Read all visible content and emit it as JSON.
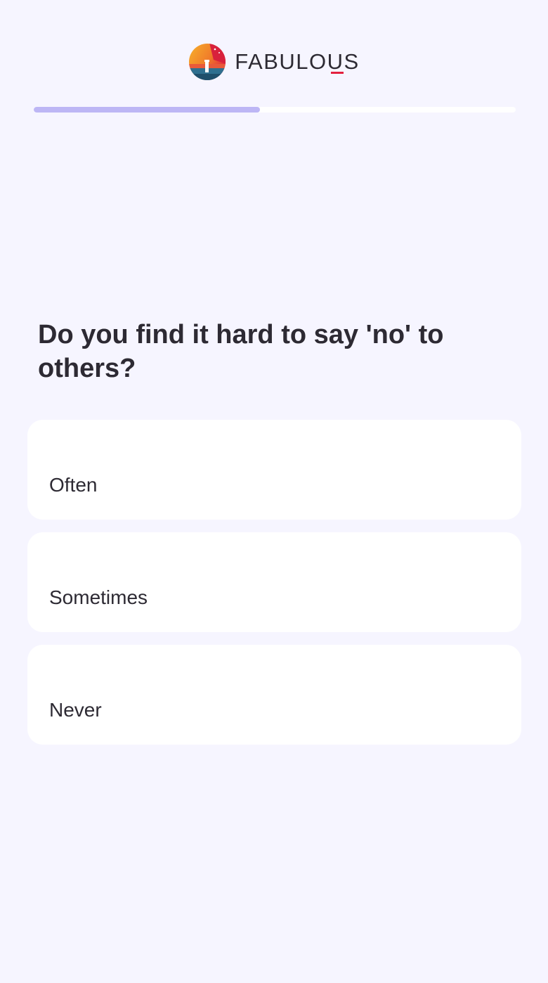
{
  "header": {
    "logo_icon": "fabulous-sunset-lighthouse-logo",
    "brand_name": "FABULOUS"
  },
  "progress": {
    "fraction": 0.47,
    "fill_color": "#bdb6f5",
    "track_color": "#ffffff"
  },
  "question": {
    "text": "Do you find it hard to say 'no' to others?"
  },
  "options": [
    {
      "label": "Often"
    },
    {
      "label": "Sometimes"
    },
    {
      "label": "Never"
    }
  ],
  "colors": {
    "background": "#f6f5ff",
    "text": "#2d2a33",
    "brand_accent": "#e3203f"
  }
}
